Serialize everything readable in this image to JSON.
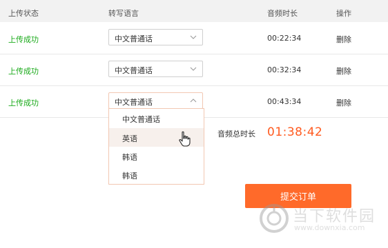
{
  "header": {
    "status_col": "上传状态",
    "language_col": "转写语言",
    "duration_col": "音频时长",
    "action_col": "操作"
  },
  "rows": [
    {
      "status": "上传成功",
      "language": "中文普通话",
      "duration": "00:22:34",
      "action": "删除"
    },
    {
      "status": "上传成功",
      "language": "中文普通话",
      "duration": "00:32:34",
      "action": "删除"
    },
    {
      "status": "上传成功",
      "language": "中文普通话",
      "duration": "00:43:34",
      "action": "删除"
    }
  ],
  "dropdown": {
    "options": [
      "中文普通话",
      "英语",
      "韩语",
      "韩语"
    ],
    "hovered_option": "英语"
  },
  "summary": {
    "total_label": "音频总时长",
    "total_value": "01:38:42"
  },
  "submit_label": "提交订单",
  "watermark": {
    "title": "当下软件园",
    "url": "www.downxia.com"
  },
  "colors": {
    "success": "#1aaa1a",
    "accent": "#ff6a2a",
    "total": "#ff5a1f"
  }
}
